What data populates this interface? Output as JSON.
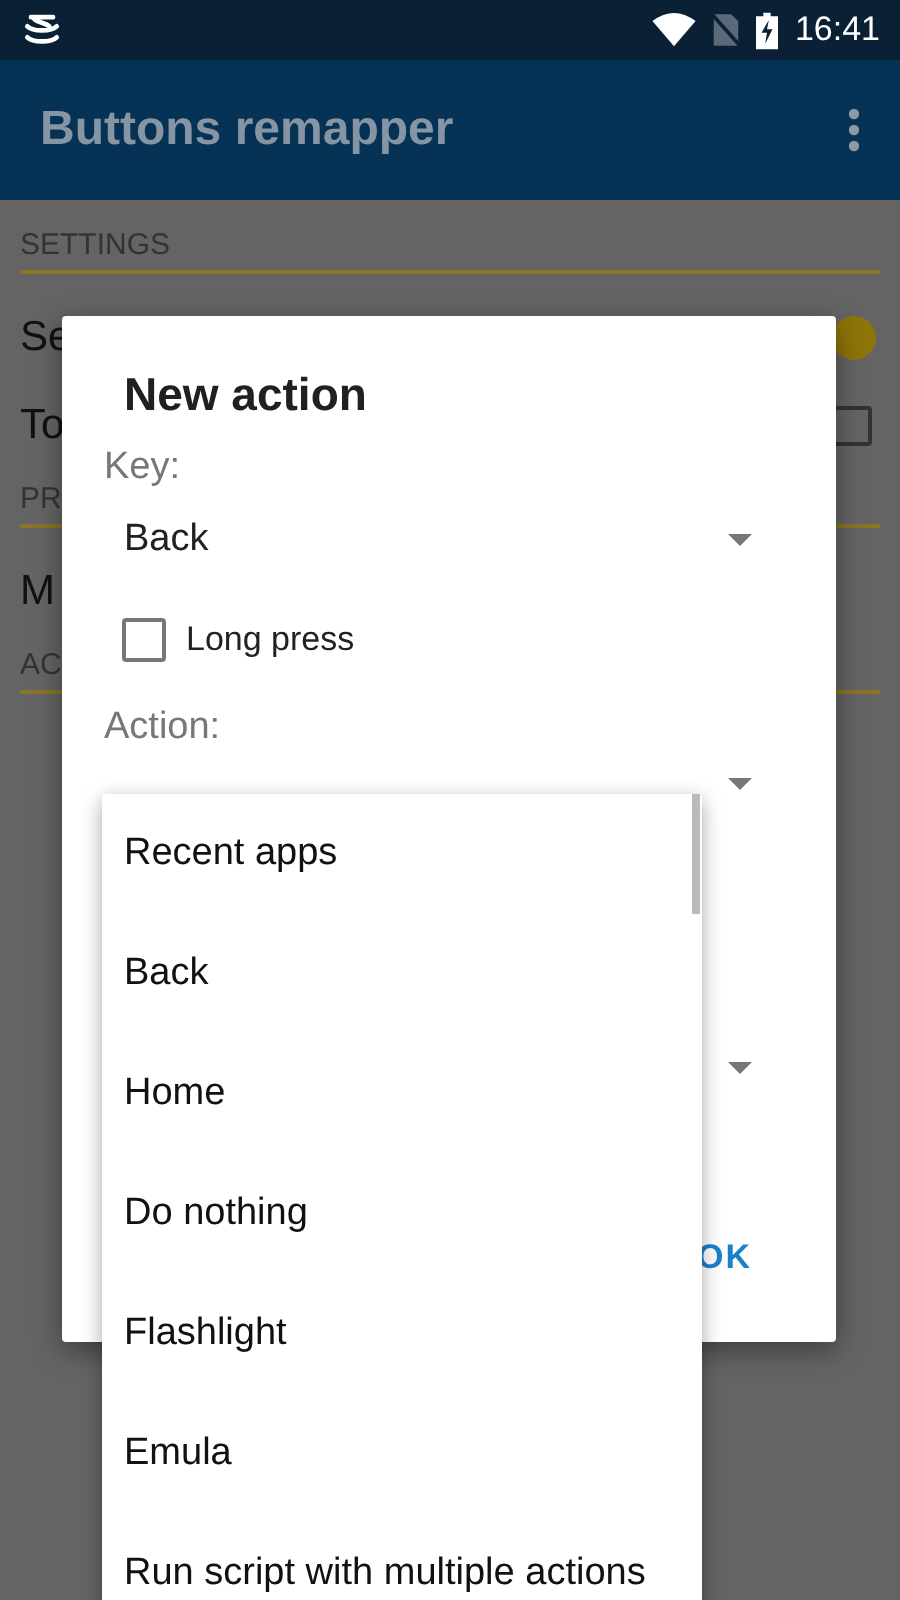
{
  "status_bar": {
    "time": "16:41"
  },
  "app_bar": {
    "title": "Buttons remapper"
  },
  "background": [
    {
      "kind": "header",
      "text": "SETTINGS"
    },
    {
      "kind": "switch",
      "text": "Se",
      "on": true
    },
    {
      "kind": "checkbox",
      "text": "To",
      "checked": false
    },
    {
      "kind": "header",
      "text": "PR"
    },
    {
      "kind": "plain",
      "text": "M"
    },
    {
      "kind": "header",
      "text": "AC"
    }
  ],
  "dialog": {
    "title": "New action",
    "key_label": "Key:",
    "key_value": "Back",
    "long_press": {
      "label": "Long press",
      "checked": false
    },
    "action_label": "Action:",
    "ok": "OK"
  },
  "popup": {
    "items": [
      {
        "label": "Recent apps"
      },
      {
        "label": "Back"
      },
      {
        "label": "Home"
      },
      {
        "label": "Do nothing"
      },
      {
        "label": "Flashlight"
      },
      {
        "label": "Emula"
      },
      {
        "label": "Run script with multiple actions"
      }
    ]
  }
}
